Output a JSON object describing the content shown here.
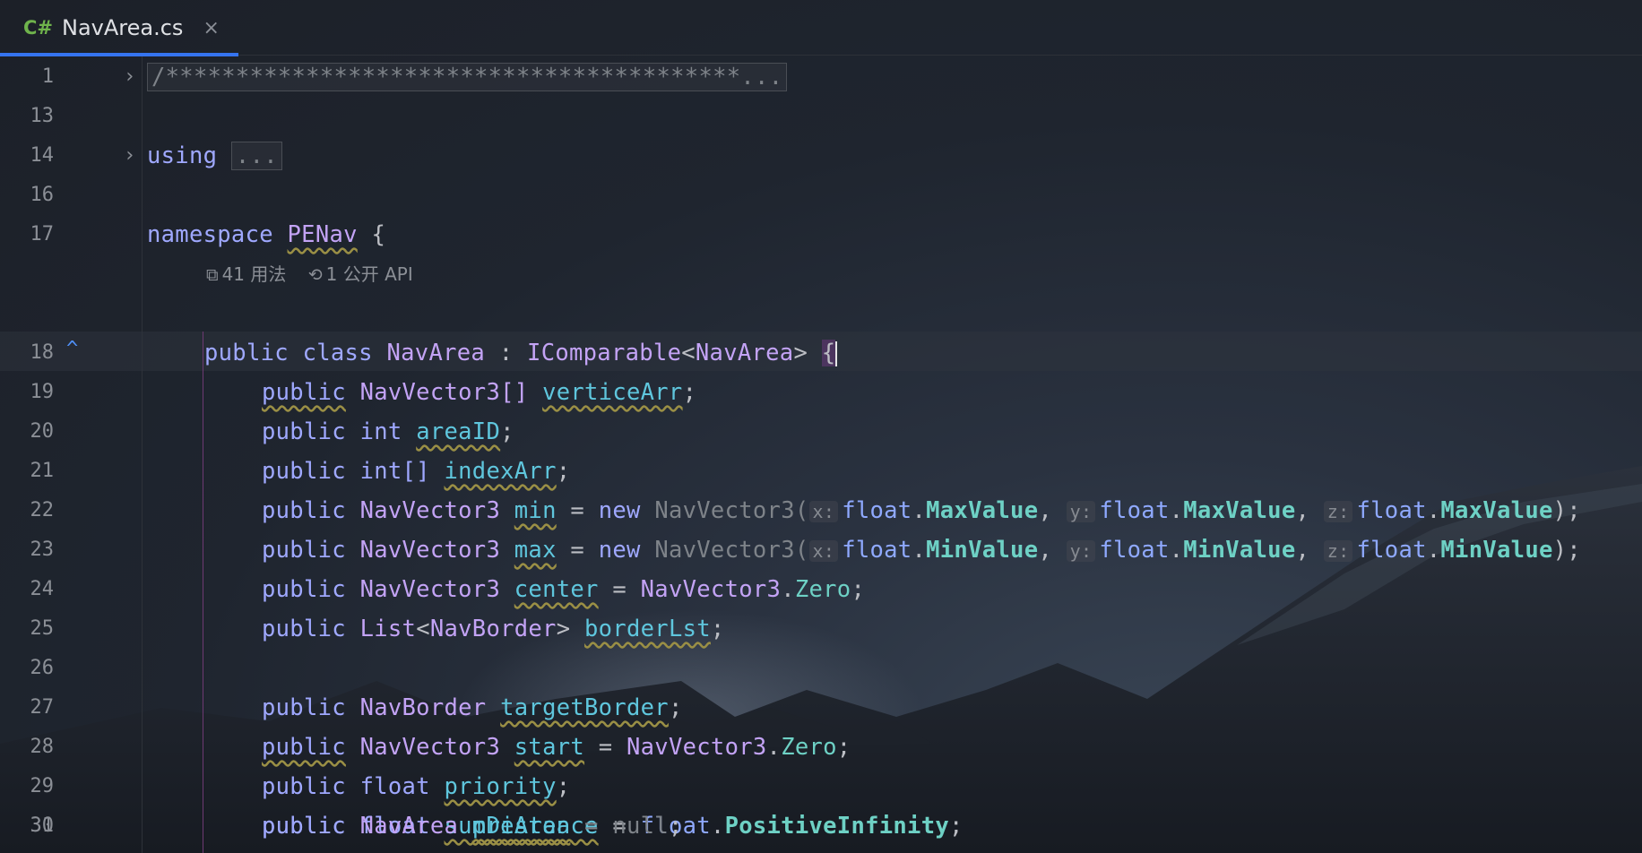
{
  "tab": {
    "lang": "C#",
    "name": "NavArea.cs",
    "close": "×"
  },
  "codelens": {
    "usages": "41 用法",
    "api": "1 公开 API"
  },
  "lines": {
    "l1": "1",
    "l13": "13",
    "l14": "14",
    "l16": "16",
    "l17": "17",
    "l18": "18",
    "l19": "19",
    "l20": "20",
    "l21": "21",
    "l22": "22",
    "l23": "23",
    "l24": "24",
    "l25": "25",
    "l26": "26",
    "l27": "27",
    "l28": "28",
    "l29": "29",
    "l30": "30",
    "l31": "31"
  },
  "code": {
    "comment": "/*****************************************...",
    "using_kw": "using",
    "using_fold": "...",
    "namespace_kw": "namespace",
    "namespace_name": "PENav",
    "brace_open": "{",
    "public": "public",
    "class": "class",
    "class_name": "NavArea",
    "colon": ":",
    "icomparable": "IComparable",
    "lt": "<",
    "gt": ">",
    "NavVector3": "NavVector3",
    "NavVector3_arr": "NavVector3[]",
    "verticeArr": "verticeArr",
    "int": "int",
    "int_arr": "int[]",
    "areaID": "areaID",
    "indexArr": "indexArr",
    "min": "min",
    "max": "max",
    "eq": "=",
    "new": "new",
    "ctor": "NavVector3(",
    "hint_x": "x:",
    "hint_y": "y:",
    "hint_z": "z:",
    "float": "float",
    "dot": ".",
    "comma": ",",
    "MaxValue": "MaxValue",
    "MinValue": "MinValue",
    "close_paren": ");",
    "semi": ";",
    "center": "center",
    "Zero": "Zero",
    "List": "List",
    "NavBorder": "NavBorder",
    "borderLst": "borderLst",
    "targetBorder": "targetBorder",
    "start": "start",
    "priority": "priority",
    "sumDistance": "sumDistance",
    "PositiveInfinity": "PositiveInfinity",
    "preArea": "preArea",
    "null": "null"
  },
  "icons": {
    "fold": "chevron-right-icon",
    "implement": "implemented-up-icon"
  },
  "colors": {
    "accent": "#3574f0",
    "keyword": "#9fa8ff",
    "type": "#c3a3f5",
    "field": "#5fc6dd"
  }
}
